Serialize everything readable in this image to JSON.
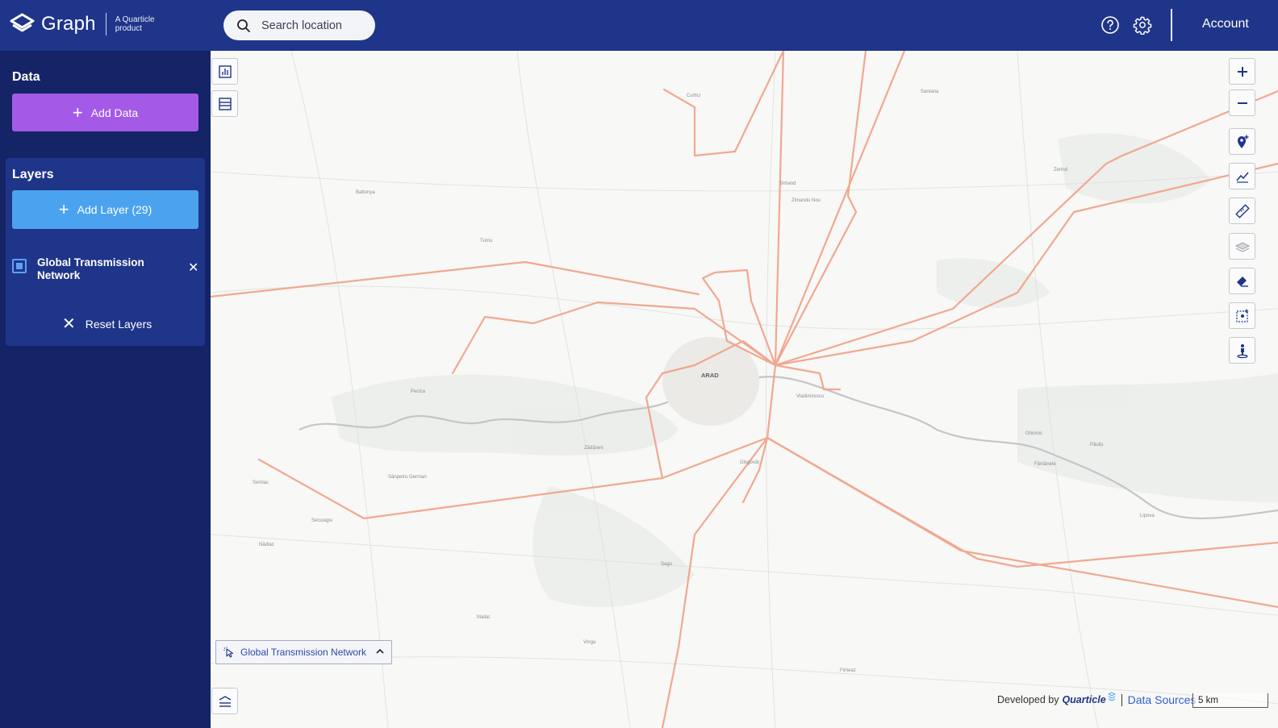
{
  "app": {
    "brand": "Graph",
    "tagline": "A Quarticle product",
    "search_placeholder": "Search location",
    "account_label": "Account",
    "colors": {
      "topbar": "#1f3589",
      "sidebar": "#152466",
      "add_data": "#a45ae6",
      "add_layer": "#4ba3ef",
      "transmission": "#f0a087"
    }
  },
  "toolbar": {
    "help_icon": "help-circle-icon",
    "settings_icon": "gear-icon"
  },
  "sidebar": {
    "data_title": "Data",
    "add_data_label": "Add Data",
    "layers_title": "Layers",
    "add_layer_label": "Add Layer (29)",
    "layers": [
      {
        "label": "Global Transmission Network",
        "checked": true
      }
    ],
    "reset_label": "Reset Layers"
  },
  "map": {
    "active_layer_chip": "Global Transmission Network",
    "attribution_prefix": "Developed by",
    "attribution_brand": "Quarticle",
    "data_sources_label": "Data Sources",
    "scale_label": "5 km",
    "places": {
      "arad": "ARAD",
      "pecica": "Pecica",
      "zimandu": "Zimandu Nou",
      "curtici": "Curtici",
      "santana": "Santana",
      "vladimirescu": "Vladimirescu",
      "fantanele": "Fântânele",
      "sanpetru": "Sânpetru German",
      "sagu": "Șagu",
      "zadareni": "Zădăreni",
      "vinga": "Vinga",
      "glogovat": "Glogovăț",
      "semlac": "Semlac",
      "battonya": "Battonya",
      "turnu": "Turnu",
      "simand": "Șimand",
      "zerind": "Zerind",
      "ghioroc": "Ghioroc",
      "paulis": "Păuliș",
      "lipova": "Lipova",
      "nadlac": "Nădlac",
      "mailat": "Mailat",
      "secusigiu": "Secusigiu",
      "firiteaz": "Firiteaz"
    }
  }
}
